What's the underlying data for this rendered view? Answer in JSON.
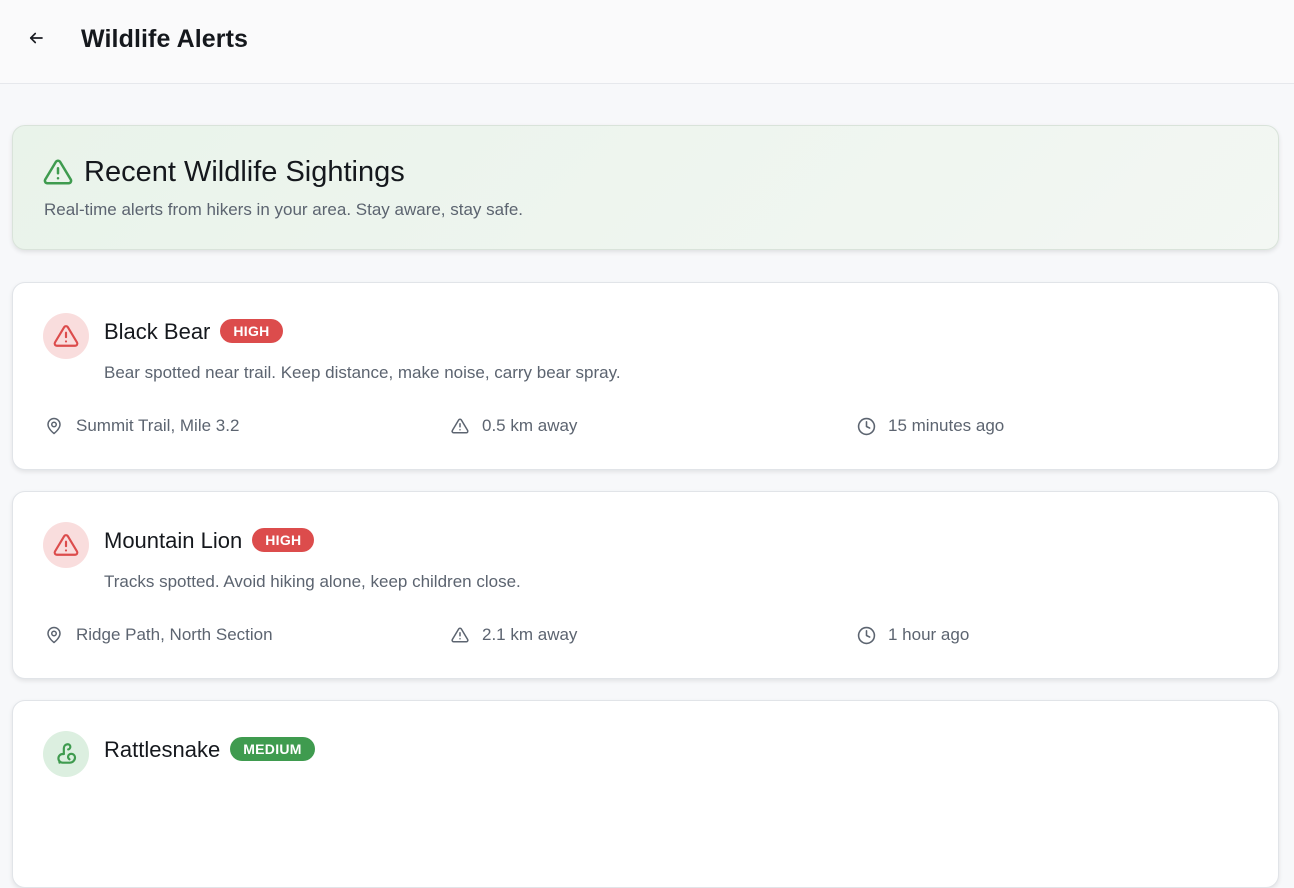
{
  "header": {
    "title": "Wildlife Alerts",
    "back_icon": "arrow-left-icon"
  },
  "hero": {
    "icon": "warning-triangle-icon",
    "title": "Recent Wildlife Sightings",
    "subtitle": "Real-time alerts from hikers in your area. Stay aware, stay safe."
  },
  "colors": {
    "high": "#dc4c4c",
    "high_bg": "#f9dddd",
    "medium": "#3f9b4f",
    "medium_bg": "#dcefe0",
    "accent_green": "#3f9b4f"
  },
  "alerts": [
    {
      "animal": "Black Bear",
      "severity": "HIGH",
      "level": "high",
      "icon": "warning-triangle-icon",
      "description": "Bear spotted near trail. Keep distance, make noise, carry bear spray.",
      "location": "Summit Trail, Mile 3.2",
      "distance": "0.5 km away",
      "time": "15 minutes ago"
    },
    {
      "animal": "Mountain Lion",
      "severity": "HIGH",
      "level": "high",
      "icon": "warning-triangle-icon",
      "description": "Tracks spotted. Avoid hiking alone, keep children close.",
      "location": "Ridge Path, North Section",
      "distance": "2.1 km away",
      "time": "1 hour ago"
    },
    {
      "animal": "Rattlesnake",
      "severity": "MEDIUM",
      "level": "medium",
      "icon": "squirrel-icon"
    }
  ]
}
